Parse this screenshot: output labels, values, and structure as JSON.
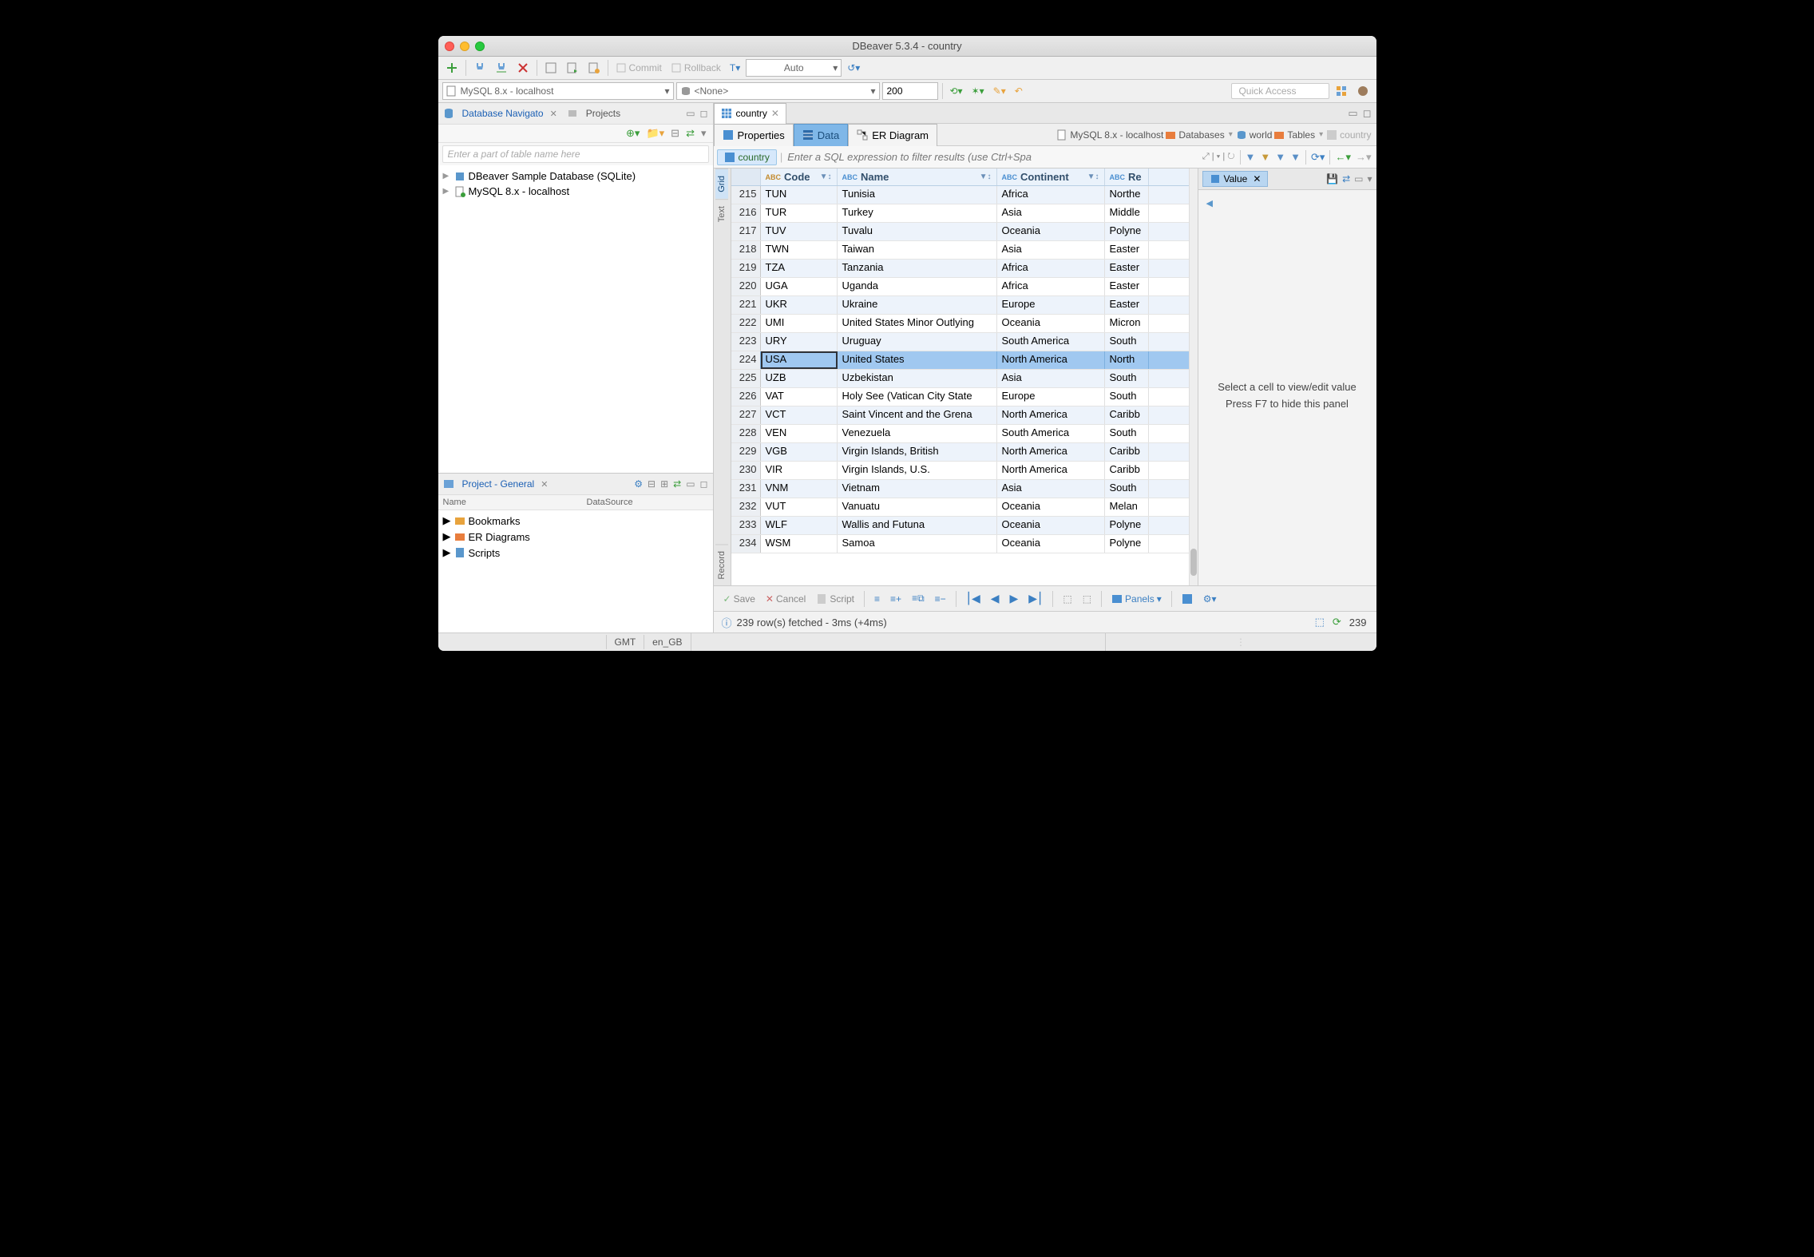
{
  "window_title": "DBeaver 5.3.4 - country",
  "toolbar1": {
    "commit": "Commit",
    "rollback": "Rollback",
    "auto": "Auto"
  },
  "toolbar2": {
    "connection": "MySQL 8.x - localhost",
    "schema": "<None>",
    "limit": "200",
    "quick_access": "Quick Access"
  },
  "navigator": {
    "title": "Database Navigato",
    "tab_projects": "Projects",
    "filter_placeholder": "Enter a part of table name here",
    "nodes": [
      "DBeaver Sample Database (SQLite)",
      "MySQL 8.x - localhost"
    ]
  },
  "project_panel": {
    "title": "Project - General",
    "col_name": "Name",
    "col_ds": "DataSource",
    "items": [
      "Bookmarks",
      "ER Diagrams",
      "Scripts"
    ]
  },
  "editor": {
    "tab": "country",
    "subtabs": {
      "props": "Properties",
      "data": "Data",
      "er": "ER Diagram"
    },
    "breadcrumbs": {
      "conn": "MySQL 8.x - localhost",
      "databases": "Databases",
      "world": "world",
      "tables": "Tables",
      "country": "country"
    },
    "filter_label": "country",
    "sql_hint": "Enter a SQL expression to filter results (use Ctrl+Spa"
  },
  "vtabs": {
    "grid": "Grid",
    "text": "Text",
    "record": "Record"
  },
  "columns": {
    "code": "Code",
    "name": "Name",
    "continent": "Continent",
    "region": "Re"
  },
  "rows": [
    {
      "n": 215,
      "code": "TUN",
      "name": "Tunisia",
      "cont": "Africa",
      "reg": "Northe"
    },
    {
      "n": 216,
      "code": "TUR",
      "name": "Turkey",
      "cont": "Asia",
      "reg": "Middle"
    },
    {
      "n": 217,
      "code": "TUV",
      "name": "Tuvalu",
      "cont": "Oceania",
      "reg": "Polyne"
    },
    {
      "n": 218,
      "code": "TWN",
      "name": "Taiwan",
      "cont": "Asia",
      "reg": "Easter"
    },
    {
      "n": 219,
      "code": "TZA",
      "name": "Tanzania",
      "cont": "Africa",
      "reg": "Easter"
    },
    {
      "n": 220,
      "code": "UGA",
      "name": "Uganda",
      "cont": "Africa",
      "reg": "Easter"
    },
    {
      "n": 221,
      "code": "UKR",
      "name": "Ukraine",
      "cont": "Europe",
      "reg": "Easter"
    },
    {
      "n": 222,
      "code": "UMI",
      "name": "United States Minor Outlying",
      "cont": "Oceania",
      "reg": "Micron"
    },
    {
      "n": 223,
      "code": "URY",
      "name": "Uruguay",
      "cont": "South America",
      "reg": "South"
    },
    {
      "n": 224,
      "code": "USA",
      "name": "United States",
      "cont": "North America",
      "reg": "North",
      "selected": true
    },
    {
      "n": 225,
      "code": "UZB",
      "name": "Uzbekistan",
      "cont": "Asia",
      "reg": "South"
    },
    {
      "n": 226,
      "code": "VAT",
      "name": "Holy See (Vatican City State",
      "cont": "Europe",
      "reg": "South"
    },
    {
      "n": 227,
      "code": "VCT",
      "name": "Saint Vincent and the Grena",
      "cont": "North America",
      "reg": "Caribb"
    },
    {
      "n": 228,
      "code": "VEN",
      "name": "Venezuela",
      "cont": "South America",
      "reg": "South"
    },
    {
      "n": 229,
      "code": "VGB",
      "name": "Virgin Islands, British",
      "cont": "North America",
      "reg": "Caribb"
    },
    {
      "n": 230,
      "code": "VIR",
      "name": "Virgin Islands, U.S.",
      "cont": "North America",
      "reg": "Caribb"
    },
    {
      "n": 231,
      "code": "VNM",
      "name": "Vietnam",
      "cont": "Asia",
      "reg": "South"
    },
    {
      "n": 232,
      "code": "VUT",
      "name": "Vanuatu",
      "cont": "Oceania",
      "reg": "Melan"
    },
    {
      "n": 233,
      "code": "WLF",
      "name": "Wallis and Futuna",
      "cont": "Oceania",
      "reg": "Polyne"
    },
    {
      "n": 234,
      "code": "WSM",
      "name": "Samoa",
      "cont": "Oceania",
      "reg": "Polyne"
    }
  ],
  "value_panel": {
    "tab": "Value",
    "hint1": "Select a cell to view/edit value",
    "hint2": "Press F7 to hide this panel"
  },
  "result_toolbar": {
    "save": "Save",
    "cancel": "Cancel",
    "script": "Script",
    "panels": "Panels"
  },
  "status": {
    "msg": "239 row(s) fetched - 3ms (+4ms)",
    "count": "239"
  },
  "footer": {
    "tz": "GMT",
    "locale": "en_GB"
  }
}
